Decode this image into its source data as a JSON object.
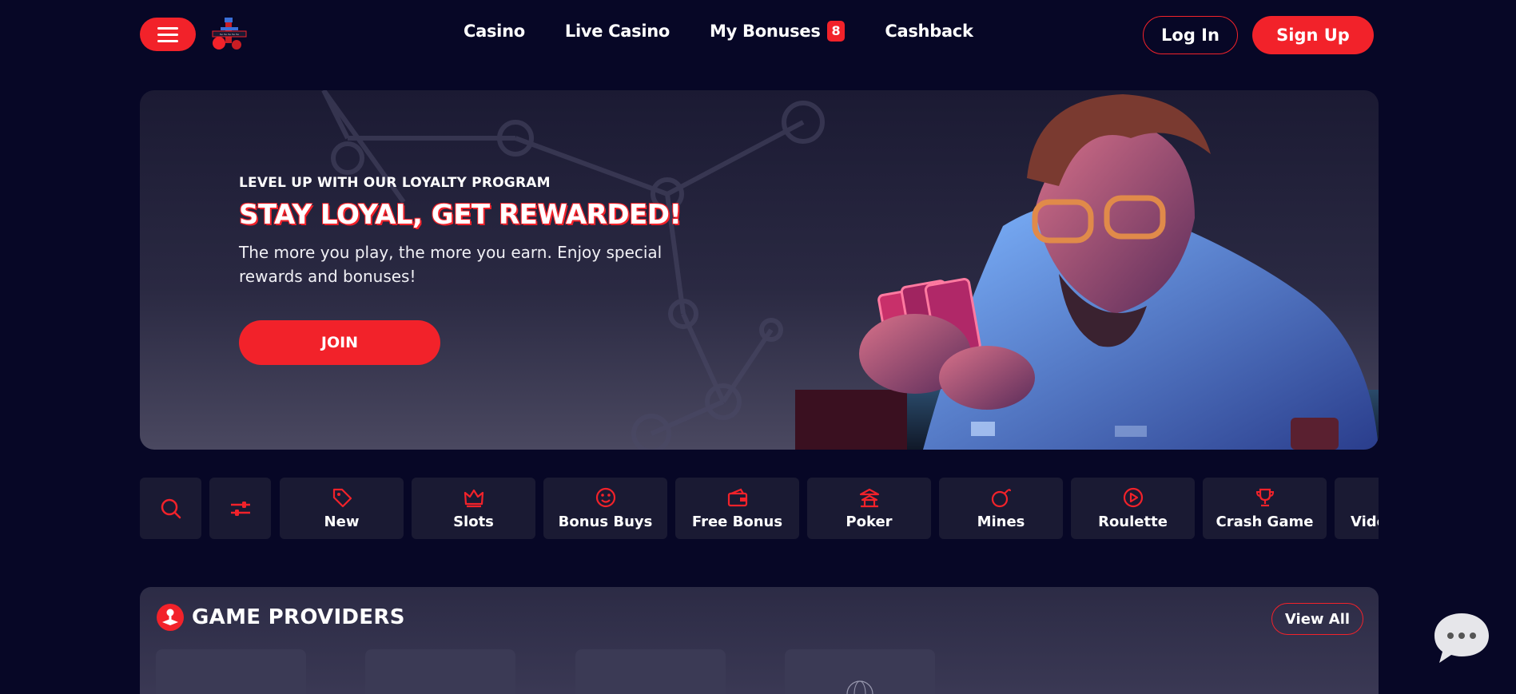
{
  "header": {
    "nav": [
      {
        "label": "Casino"
      },
      {
        "label": "Live Casino"
      },
      {
        "label": "My Bonuses",
        "badge": "8"
      },
      {
        "label": "Cashback"
      }
    ],
    "login_label": "Log In",
    "signup_label": "Sign Up"
  },
  "hero": {
    "kicker": "LEVEL UP WITH OUR LOYALTY PROGRAM",
    "title": "STAY LOYAL, GET REWARDED!",
    "description": "The more you play, the more you earn. Enjoy special rewards and bonuses!",
    "button_label": "JOIN"
  },
  "categories": [
    {
      "label": "New",
      "icon": "tag-icon"
    },
    {
      "label": "Slots",
      "icon": "crown-icon"
    },
    {
      "label": "Bonus Buys",
      "icon": "emoji-icon"
    },
    {
      "label": "Free Bonus",
      "icon": "wallet-icon"
    },
    {
      "label": "Poker",
      "icon": "pagoda-icon"
    },
    {
      "label": "Mines",
      "icon": "bomb-icon"
    },
    {
      "label": "Roulette",
      "icon": "play-circle-icon"
    },
    {
      "label": "Crash Game",
      "icon": "trophy-icon"
    },
    {
      "label": "Vide",
      "icon": "video-icon"
    }
  ],
  "providers": {
    "title": "GAME PROVIDERS",
    "view_all_label": "View All"
  },
  "colors": {
    "accent": "#f2222a",
    "background": "#070726",
    "tile": "#1a1a33"
  }
}
